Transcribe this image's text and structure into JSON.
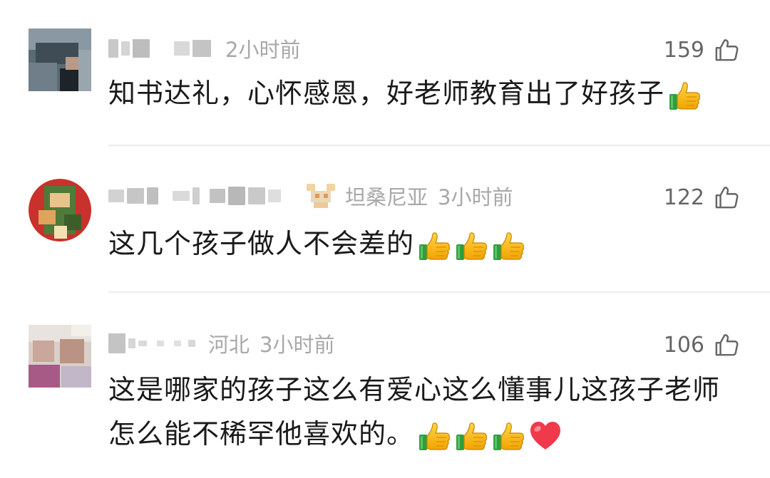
{
  "comments": [
    {
      "time": "2小时前",
      "region": "",
      "likes": "159",
      "text": "知书达礼，心怀感恩，好老师教育出了好孩子",
      "emoji": [
        "thumbs-up"
      ]
    },
    {
      "time": "3小时前",
      "region": "坦桑尼亚",
      "likes": "122",
      "text": "这几个孩子做人不会差的",
      "emoji": [
        "thumbs-up",
        "thumbs-up",
        "thumbs-up"
      ]
    },
    {
      "time": "3小时前",
      "region": "河北",
      "likes": "106",
      "text_line1": "这是哪家的孩子这么有爱心这么懂事儿这孩子老师",
      "text_line2": "怎么能不稀罕他喜欢的。",
      "emoji": [
        "thumbs-up",
        "thumbs-up",
        "thumbs-up",
        "red-heart"
      ]
    }
  ],
  "colors": {
    "meta": "#a8a8a8",
    "text": "#1a1a1a",
    "like": "#666666",
    "divider": "#ececec"
  },
  "icons": {
    "like": "thumbs-up-outline-icon"
  }
}
